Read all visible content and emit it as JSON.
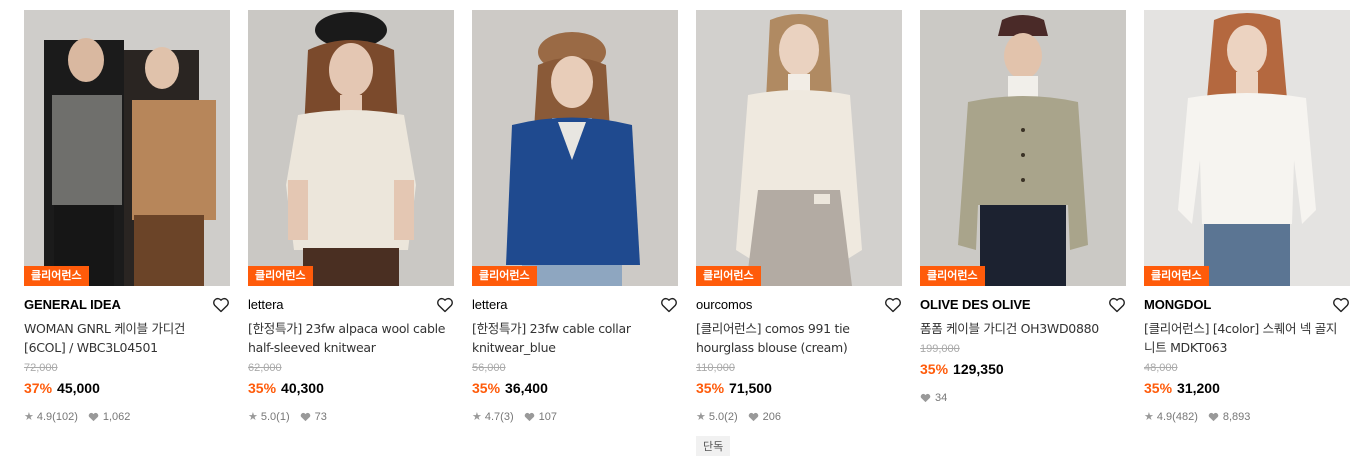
{
  "products": [
    {
      "tag": "클리어런스",
      "brand": "GENERAL IDEA",
      "name": "WOMAN GNRL 케이블 가디건 [6COL] / WBC3L04501",
      "original_price": "72,000",
      "discount": "37%",
      "price": "45,000",
      "rating": "4.9",
      "reviews": "(102)",
      "likes": "1,062",
      "exclusive": ""
    },
    {
      "tag": "클리어런스",
      "brand": "lettera",
      "name": "[한정특가] 23fw alpaca wool cable half-sleeved knitwear",
      "original_price": "62,000",
      "discount": "35%",
      "price": "40,300",
      "rating": "5.0",
      "reviews": "(1)",
      "likes": "73",
      "exclusive": ""
    },
    {
      "tag": "클리어런스",
      "brand": "lettera",
      "name": "[한정특가] 23fw cable collar knitwear_blue",
      "original_price": "56,000",
      "discount": "35%",
      "price": "36,400",
      "rating": "4.7",
      "reviews": "(3)",
      "likes": "107",
      "exclusive": ""
    },
    {
      "tag": "클리어런스",
      "brand": "ourcomos",
      "name": "[클리어런스] comos 991 tie hourglass blouse (cream)",
      "original_price": "110,000",
      "discount": "35%",
      "price": "71,500",
      "rating": "5.0",
      "reviews": "(2)",
      "likes": "206",
      "exclusive": "단독"
    },
    {
      "tag": "클리어런스",
      "brand": "OLIVE DES OLIVE",
      "name": "폼폼 케이블 가디건 OH3WD0880",
      "original_price": "199,000",
      "discount": "35%",
      "price": "129,350",
      "rating": "",
      "reviews": "",
      "likes": "34",
      "exclusive": ""
    },
    {
      "tag": "클리어런스",
      "brand": "MONGDOL",
      "name": "[클리어런스] [4color] 스퀘어 넥 골지 니트 MDKT063",
      "original_price": "48,000",
      "discount": "35%",
      "price": "31,200",
      "rating": "4.9",
      "reviews": "(482)",
      "likes": "8,893",
      "exclusive": ""
    }
  ],
  "icons": {
    "wishlist": "heart-outline-icon",
    "rating": "star-icon",
    "likes": "heart-filled-icon"
  },
  "colors": {
    "accent": "#ff5b0a",
    "muted": "#aaaaaa"
  }
}
